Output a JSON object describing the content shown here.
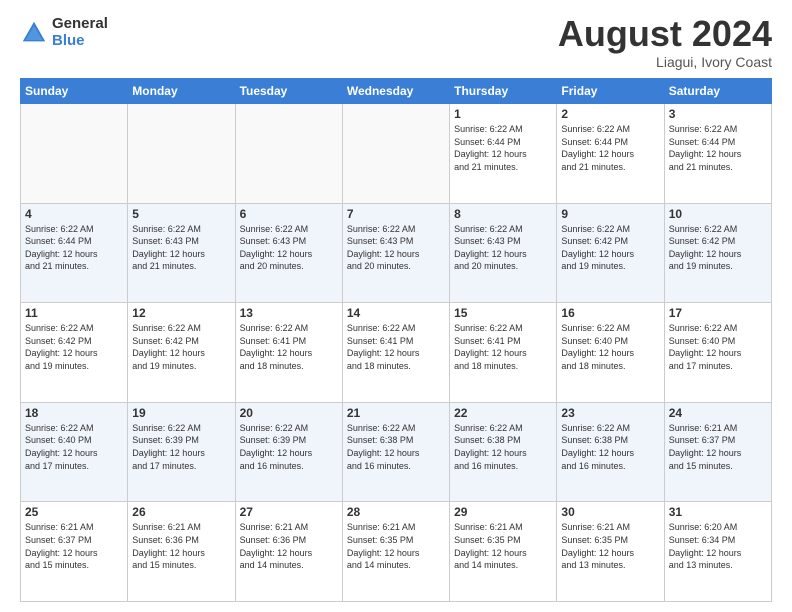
{
  "header": {
    "logo_general": "General",
    "logo_blue": "Blue",
    "title": "August 2024",
    "location": "Liagui, Ivory Coast"
  },
  "days_of_week": [
    "Sunday",
    "Monday",
    "Tuesday",
    "Wednesday",
    "Thursday",
    "Friday",
    "Saturday"
  ],
  "weeks": [
    [
      {
        "day": "",
        "info": ""
      },
      {
        "day": "",
        "info": ""
      },
      {
        "day": "",
        "info": ""
      },
      {
        "day": "",
        "info": ""
      },
      {
        "day": "1",
        "info": "Sunrise: 6:22 AM\nSunset: 6:44 PM\nDaylight: 12 hours\nand 21 minutes."
      },
      {
        "day": "2",
        "info": "Sunrise: 6:22 AM\nSunset: 6:44 PM\nDaylight: 12 hours\nand 21 minutes."
      },
      {
        "day": "3",
        "info": "Sunrise: 6:22 AM\nSunset: 6:44 PM\nDaylight: 12 hours\nand 21 minutes."
      }
    ],
    [
      {
        "day": "4",
        "info": "Sunrise: 6:22 AM\nSunset: 6:44 PM\nDaylight: 12 hours\nand 21 minutes."
      },
      {
        "day": "5",
        "info": "Sunrise: 6:22 AM\nSunset: 6:43 PM\nDaylight: 12 hours\nand 21 minutes."
      },
      {
        "day": "6",
        "info": "Sunrise: 6:22 AM\nSunset: 6:43 PM\nDaylight: 12 hours\nand 20 minutes."
      },
      {
        "day": "7",
        "info": "Sunrise: 6:22 AM\nSunset: 6:43 PM\nDaylight: 12 hours\nand 20 minutes."
      },
      {
        "day": "8",
        "info": "Sunrise: 6:22 AM\nSunset: 6:43 PM\nDaylight: 12 hours\nand 20 minutes."
      },
      {
        "day": "9",
        "info": "Sunrise: 6:22 AM\nSunset: 6:42 PM\nDaylight: 12 hours\nand 19 minutes."
      },
      {
        "day": "10",
        "info": "Sunrise: 6:22 AM\nSunset: 6:42 PM\nDaylight: 12 hours\nand 19 minutes."
      }
    ],
    [
      {
        "day": "11",
        "info": "Sunrise: 6:22 AM\nSunset: 6:42 PM\nDaylight: 12 hours\nand 19 minutes."
      },
      {
        "day": "12",
        "info": "Sunrise: 6:22 AM\nSunset: 6:42 PM\nDaylight: 12 hours\nand 19 minutes."
      },
      {
        "day": "13",
        "info": "Sunrise: 6:22 AM\nSunset: 6:41 PM\nDaylight: 12 hours\nand 18 minutes."
      },
      {
        "day": "14",
        "info": "Sunrise: 6:22 AM\nSunset: 6:41 PM\nDaylight: 12 hours\nand 18 minutes."
      },
      {
        "day": "15",
        "info": "Sunrise: 6:22 AM\nSunset: 6:41 PM\nDaylight: 12 hours\nand 18 minutes."
      },
      {
        "day": "16",
        "info": "Sunrise: 6:22 AM\nSunset: 6:40 PM\nDaylight: 12 hours\nand 18 minutes."
      },
      {
        "day": "17",
        "info": "Sunrise: 6:22 AM\nSunset: 6:40 PM\nDaylight: 12 hours\nand 17 minutes."
      }
    ],
    [
      {
        "day": "18",
        "info": "Sunrise: 6:22 AM\nSunset: 6:40 PM\nDaylight: 12 hours\nand 17 minutes."
      },
      {
        "day": "19",
        "info": "Sunrise: 6:22 AM\nSunset: 6:39 PM\nDaylight: 12 hours\nand 17 minutes."
      },
      {
        "day": "20",
        "info": "Sunrise: 6:22 AM\nSunset: 6:39 PM\nDaylight: 12 hours\nand 16 minutes."
      },
      {
        "day": "21",
        "info": "Sunrise: 6:22 AM\nSunset: 6:38 PM\nDaylight: 12 hours\nand 16 minutes."
      },
      {
        "day": "22",
        "info": "Sunrise: 6:22 AM\nSunset: 6:38 PM\nDaylight: 12 hours\nand 16 minutes."
      },
      {
        "day": "23",
        "info": "Sunrise: 6:22 AM\nSunset: 6:38 PM\nDaylight: 12 hours\nand 16 minutes."
      },
      {
        "day": "24",
        "info": "Sunrise: 6:21 AM\nSunset: 6:37 PM\nDaylight: 12 hours\nand 15 minutes."
      }
    ],
    [
      {
        "day": "25",
        "info": "Sunrise: 6:21 AM\nSunset: 6:37 PM\nDaylight: 12 hours\nand 15 minutes."
      },
      {
        "day": "26",
        "info": "Sunrise: 6:21 AM\nSunset: 6:36 PM\nDaylight: 12 hours\nand 15 minutes."
      },
      {
        "day": "27",
        "info": "Sunrise: 6:21 AM\nSunset: 6:36 PM\nDaylight: 12 hours\nand 14 minutes."
      },
      {
        "day": "28",
        "info": "Sunrise: 6:21 AM\nSunset: 6:35 PM\nDaylight: 12 hours\nand 14 minutes."
      },
      {
        "day": "29",
        "info": "Sunrise: 6:21 AM\nSunset: 6:35 PM\nDaylight: 12 hours\nand 14 minutes."
      },
      {
        "day": "30",
        "info": "Sunrise: 6:21 AM\nSunset: 6:35 PM\nDaylight: 12 hours\nand 13 minutes."
      },
      {
        "day": "31",
        "info": "Sunrise: 6:20 AM\nSunset: 6:34 PM\nDaylight: 12 hours\nand 13 minutes."
      }
    ]
  ]
}
